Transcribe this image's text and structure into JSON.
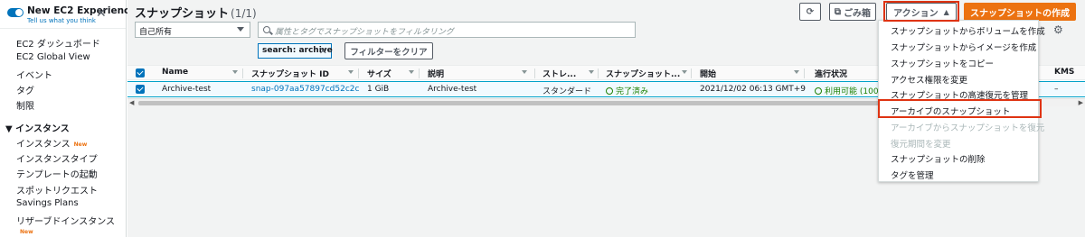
{
  "sidebar": {
    "experience_title": "New EC2 Experience",
    "experience_sub": "Tell us what you think",
    "items": [
      {
        "label": "EC2 ダッシュボード"
      },
      {
        "label": "EC2 Global View"
      },
      {
        "label": "イベント"
      },
      {
        "label": "タグ"
      },
      {
        "label": "制限"
      }
    ],
    "section_instances": "インスタンス",
    "instance_items": [
      {
        "label": "インスタンス",
        "badge": "New"
      },
      {
        "label": "インスタンスタイプ"
      },
      {
        "label": "テンプレートの起動"
      },
      {
        "label": "スポットリクエスト"
      },
      {
        "label": "Savings Plans"
      },
      {
        "label": "リザーブドインスタンス"
      }
    ],
    "bottom_badge": "New"
  },
  "header": {
    "title": "スナップショット",
    "count": "(1/1)",
    "trash_label": "ごみ箱",
    "actions_label": "アクション",
    "create_label": "スナップショットの作成"
  },
  "filters": {
    "owner_select": "自己所有",
    "search_placeholder": "属性とタグでスナップショットをフィルタリング",
    "token_label": "search: archive",
    "clear_label": "フィルターをクリア"
  },
  "table": {
    "columns": [
      "Name",
      "スナップショット ID",
      "サイズ",
      "説明",
      "ストレ...",
      "スナップショット...",
      "開始",
      "進行状況",
      "KMS"
    ],
    "row": {
      "name": "Archive-test",
      "snapshot_id": "snap-097aa57897cd52c2c",
      "size": "1 GiB",
      "description": "Archive-test",
      "storage": "スタンダード",
      "status": "完了済み",
      "started": "2021/12/02 06:13 GMT+9",
      "progress": "利用可能 (100%",
      "kms": "–"
    }
  },
  "menu": {
    "items": [
      {
        "label": "スナップショットからボリュームを作成",
        "disabled": false
      },
      {
        "label": "スナップショットからイメージを作成",
        "disabled": false
      },
      {
        "label": "スナップショットをコピー",
        "disabled": false
      },
      {
        "label": "アクセス権限を変更",
        "disabled": false
      },
      {
        "label": "スナップショットの高速復元を管理",
        "disabled": false
      },
      {
        "label": "アーカイブのスナップショット",
        "disabled": false
      },
      {
        "label": "アーカイブからスナップショットを復元",
        "disabled": true
      },
      {
        "label": "復元期間を変更",
        "disabled": true
      },
      {
        "label": "スナップショットの削除",
        "disabled": false
      },
      {
        "label": "タグを管理",
        "disabled": false
      }
    ]
  },
  "colors": {
    "accent": "#0073bb",
    "primary_button": "#ec7211",
    "highlight": "#df3312",
    "success": "#1d8102"
  }
}
